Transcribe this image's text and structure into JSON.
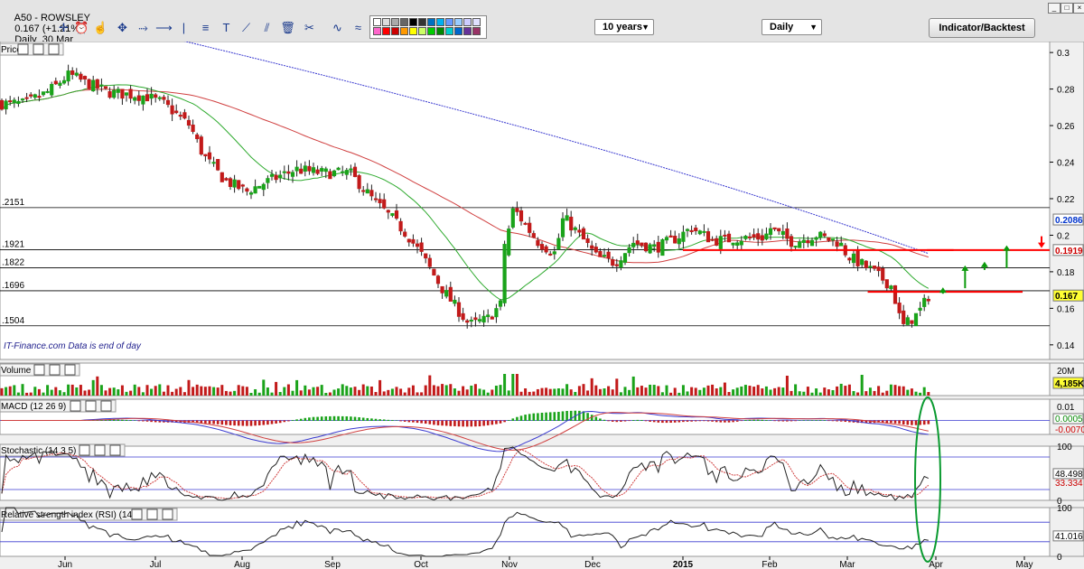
{
  "header": {
    "symbol": "A50 - ROWSLEY",
    "price_change": "0.167 (+1.21%)",
    "period_date": "Daily  30 Mar"
  },
  "toolbar": {
    "range_select": "10 years",
    "interval_select": "Daily",
    "indicator_button": "Indicator/Backtest",
    "tools": [
      "crosshair-icon",
      "alarm-icon",
      "hand-icon",
      "arrows-icon",
      "horizontal-line-icon",
      "text-icon",
      "fibonacci-icon",
      "trend-line-icon",
      "channel-icon",
      "parallel-lines-icon",
      "trash-icon",
      "scissors-icon",
      "line-style-icon",
      "line-width-icon"
    ]
  },
  "colors": {
    "up": "#1aa31a",
    "down": "#c21a1a",
    "ma_short": "#2eaa2e",
    "ma_mid": "#d04040",
    "ma_long": "#3a3ad0",
    "annotation": "#ff0000",
    "arrow": "#0a9a0a",
    "ellipse": "#0a9a30",
    "bg": "#ffffff",
    "watermark": "#1e1e8c"
  },
  "watermark": "IT-Finance.com  Data is end of day",
  "chart_data": [
    {
      "type": "candlestick",
      "panel": "Price",
      "panel_label": "Price",
      "x_ticks": [
        "Jun",
        "Jul",
        "Aug",
        "Sep",
        "Oct",
        "Nov",
        "Dec",
        "2015",
        "Feb",
        "Mar",
        "Apr",
        "May"
      ],
      "y_ticks": [
        0.14,
        0.16,
        0.18,
        0.2,
        0.22,
        0.24,
        0.26,
        0.28,
        0.3
      ],
      "y_tick_labels": [
        "0.14",
        "0.16",
        "0.18",
        "0.2",
        "0.22",
        "0.24",
        "0.26",
        "0.28",
        "0.3"
      ],
      "ylim": [
        0.132,
        0.306
      ],
      "close_anchors": [
        [
          "Jun",
          -0.45,
          0.272
        ],
        [
          "Jun",
          -0.2,
          0.278
        ],
        [
          "Jun",
          0.05,
          0.288
        ],
        [
          "Jun",
          0.25,
          0.283
        ],
        [
          "Jun",
          0.5,
          0.278
        ],
        [
          "Jun",
          0.9,
          0.276
        ],
        [
          "Jul",
          0.1,
          0.272
        ],
        [
          "Jul",
          0.4,
          0.26
        ],
        [
          "Jul",
          0.55,
          0.244
        ],
        [
          "Jul",
          0.8,
          0.23
        ],
        [
          "Aug",
          0.05,
          0.224
        ],
        [
          "Aug",
          0.4,
          0.232
        ],
        [
          "Aug",
          0.6,
          0.236
        ],
        [
          "Aug",
          0.9,
          0.234
        ],
        [
          "Sep",
          0.2,
          0.234
        ],
        [
          "Sep",
          0.45,
          0.22
        ],
        [
          "Sep",
          0.7,
          0.208
        ],
        [
          "Sep",
          0.85,
          0.2
        ],
        [
          "Oct",
          0.0,
          0.19
        ],
        [
          "Oct",
          0.25,
          0.17
        ],
        [
          "Oct",
          0.45,
          0.157
        ],
        [
          "Oct",
          0.55,
          0.151
        ],
        [
          "Oct",
          0.75,
          0.154
        ],
        [
          "Oct",
          0.9,
          0.162
        ],
        [
          "Nov",
          -0.05,
          0.195
        ],
        [
          "Nov",
          0.05,
          0.215
        ],
        [
          "Nov",
          0.2,
          0.205
        ],
        [
          "Nov",
          0.35,
          0.196
        ],
        [
          "Nov",
          0.55,
          0.19
        ],
        [
          "Nov",
          0.65,
          0.21
        ],
        [
          "Nov",
          0.9,
          0.197
        ],
        [
          "Dec",
          0.05,
          0.188
        ],
        [
          "Dec",
          0.25,
          0.185
        ],
        [
          "Dec",
          0.45,
          0.196
        ],
        [
          "Dec",
          0.7,
          0.193
        ],
        [
          "Dec",
          0.95,
          0.199
        ],
        [
          "2015",
          0.1,
          0.204
        ],
        [
          "2015",
          0.35,
          0.197
        ],
        [
          "2015",
          0.6,
          0.198
        ],
        [
          "2015",
          0.95,
          0.199
        ],
        [
          "Feb",
          0.0,
          0.204
        ],
        [
          "Feb",
          0.3,
          0.196
        ],
        [
          "Feb",
          0.6,
          0.2
        ],
        [
          "Feb",
          0.9,
          0.196
        ],
        [
          "Mar",
          0.0,
          0.189
        ],
        [
          "Mar",
          0.3,
          0.18
        ],
        [
          "Mar",
          0.5,
          0.172
        ],
        [
          "Mar",
          0.62,
          0.15
        ],
        [
          "Mar",
          0.8,
          0.157
        ],
        [
          "Mar",
          0.92,
          0.167
        ]
      ],
      "horizontal_levels": [
        {
          "value": 0.2151,
          "label": ".2151"
        },
        {
          "value": 0.1921,
          "label": ".1921"
        },
        {
          "value": 0.1822,
          "label": ".1822"
        },
        {
          "value": 0.1696,
          "label": ".1696"
        },
        {
          "value": 0.1504,
          "label": ".1504"
        }
      ],
      "price_tags": [
        {
          "value": 0.2086,
          "label": "0.2086",
          "color": "blue"
        },
        {
          "value": 0.1919,
          "label": "0.1919",
          "color": "red"
        },
        {
          "value": 0.167,
          "label": "0.167",
          "color": "yellow"
        }
      ],
      "resistance_lines": [
        {
          "from": [
            "Jan",
            0.0
          ],
          "to": [
            "Mar",
            1.2
          ],
          "value": 0.1919
        },
        {
          "from": [
            "Mar",
            0.23
          ],
          "to": [
            "Apr",
            0.98
          ],
          "value": 0.169
        }
      ],
      "ma_labels": [
        "short moving average",
        "medium moving average",
        "long moving average"
      ]
    },
    {
      "type": "bar",
      "panel": "Volume",
      "panel_label": "Volume",
      "y_tick_labels": [
        "20M",
        "4,185K"
      ]
    },
    {
      "type": "line",
      "panel": "MACD",
      "panel_label": "MACD (12 26 9)",
      "y_tick_labels": [
        "0.01",
        "0.0005",
        "-0.0070"
      ]
    },
    {
      "type": "line",
      "panel": "Stochastic",
      "panel_label": "Stochastic (14 3 5)",
      "y_ticks": [
        0,
        20,
        80,
        100
      ],
      "y_tick_labels": [
        "100",
        "48.498",
        "33.334",
        "0"
      ]
    },
    {
      "type": "line",
      "panel": "RSI",
      "panel_label": "Relative strength index (RSI) (14)",
      "y_ticks": [
        0,
        30,
        70,
        100
      ],
      "y_tick_labels": [
        "100",
        "41.016",
        "0"
      ]
    }
  ]
}
